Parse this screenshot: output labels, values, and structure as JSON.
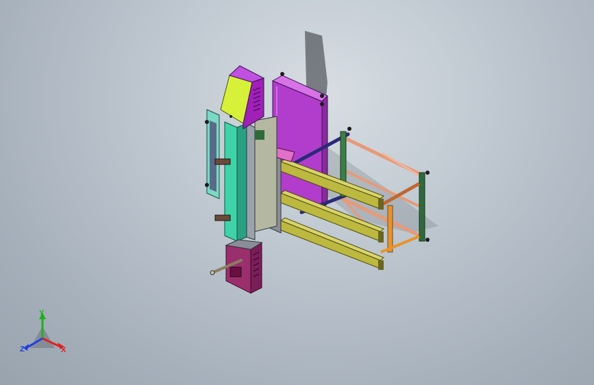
{
  "viewport": {
    "background_top": "#d7dde3",
    "background_bottom": "#98a3ae"
  },
  "triad": {
    "x_label": "X",
    "y_label": "Y",
    "z_label": "Z",
    "x_color": "#e02020",
    "y_color": "#20b020",
    "z_color": "#2040e0"
  },
  "model": {
    "colors": {
      "column": "#3fd4a8",
      "cabinet_top": "#b01fc8",
      "cabinet_top_panel": "#d7f03a",
      "cabinet_bottom": "#9b2f6e",
      "magenta_box": "#c040d8",
      "olive_arm": "#b7b23a",
      "salmon_frame": "#e89a78",
      "orange_post": "#e8942a",
      "dark_green_post": "#2f6a3a",
      "navy_bar": "#2a2a78",
      "pink_plate": "#e070c8"
    }
  }
}
